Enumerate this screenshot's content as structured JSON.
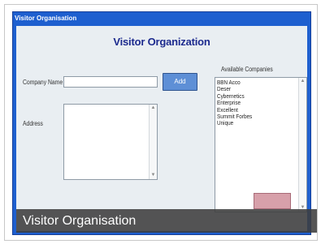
{
  "window": {
    "title": "Visitor Organisation"
  },
  "form": {
    "heading": "Visitor Organization",
    "company_label": "Company Name",
    "company_value": "",
    "add_label": "Add",
    "address_label": "Address",
    "address_value": ""
  },
  "companies": {
    "label": "Available Companies",
    "items": [
      "BBN Acco",
      "Deser",
      "Cybernetics",
      "Enterprise",
      "Excellent",
      "Summit Forbes",
      "Unique"
    ]
  },
  "caption": "Visitor Organisation",
  "icons": {
    "scroll_up": "arrow-up-icon",
    "scroll_down": "arrow-down-icon"
  },
  "colors": {
    "titlebar": "#1e5fcf",
    "heading": "#1c2a8e",
    "add_button": "#5e8fd6"
  }
}
